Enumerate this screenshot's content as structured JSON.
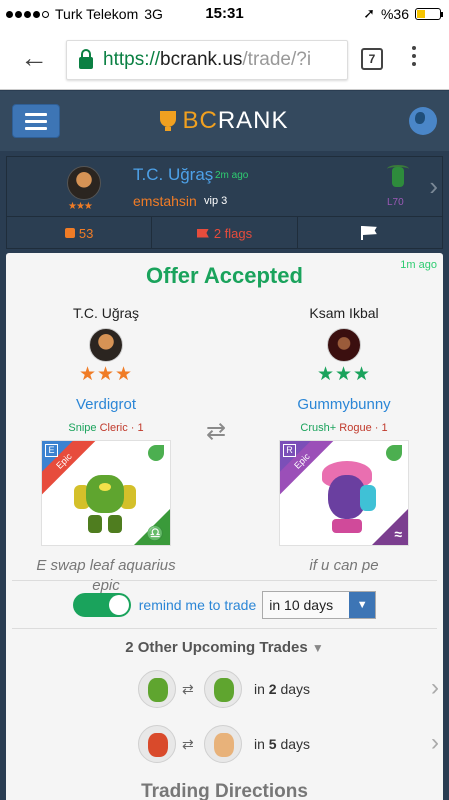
{
  "status_bar": {
    "carrier": "Turk Telekom",
    "network": "3G",
    "time": "15:31",
    "battery": "%36",
    "battery_level": 0.36
  },
  "browser": {
    "url_scheme": "https://",
    "url_host": "bcrank.us",
    "url_path": "/trade/?i",
    "tab_count": "7"
  },
  "app": {
    "brand_prefix": "BC",
    "brand_suffix": "RANK"
  },
  "summary": {
    "name": "T.C. Uğraş",
    "time": "2m ago",
    "username": "emstahsin",
    "vip": "vip 3",
    "stars": "★★★",
    "level": "L70",
    "likes": "53",
    "flags": "2 flags"
  },
  "offer": {
    "time": "1m ago",
    "title": "Offer Accepted",
    "left": {
      "player": "T.C. Uğraş",
      "stars": "★★★",
      "monster": "Verdigrot",
      "tag1": "Snipe",
      "tag2": "Cleric · 1",
      "rarity": "Epic",
      "element_letter": "E",
      "description": "E swap leaf aquarius epic"
    },
    "right": {
      "player": "Ksam Ikbal",
      "stars": "★★★",
      "monster": "Gummybunny",
      "tag1": "Crush+",
      "tag2": "Rogue · 1",
      "rarity": "Epic",
      "element_letter": "R",
      "description": "if u can pe"
    },
    "swap_icon": "⇄",
    "remind_label": "remind me to trade",
    "remind_enabled": true,
    "remind_select": "in 10 days"
  },
  "upcoming": {
    "heading": "2 Other Upcoming Trades",
    "rows": [
      {
        "prefix": "in ",
        "days": "2",
        "suffix": " days"
      },
      {
        "prefix": "in ",
        "days": "5",
        "suffix": " days"
      }
    ]
  },
  "directions": {
    "heading": "Trading Directions"
  }
}
